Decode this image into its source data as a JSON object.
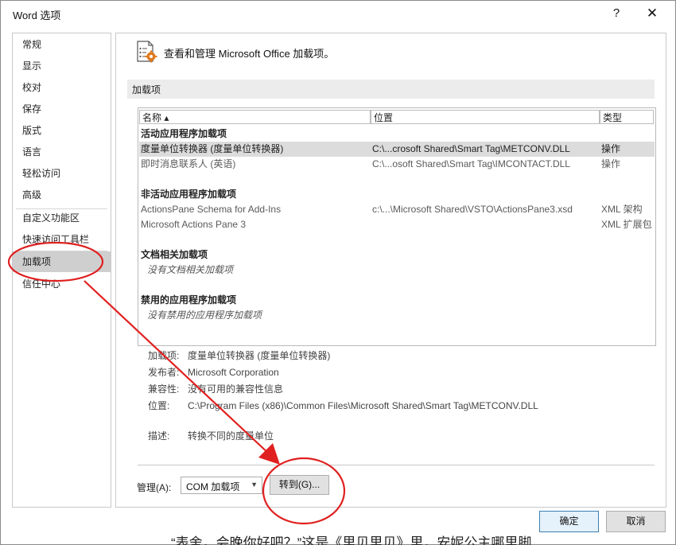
{
  "window": {
    "title": "Word 选项",
    "help": "?",
    "close": "✕"
  },
  "sidebar": {
    "items": [
      {
        "label": "常规"
      },
      {
        "label": "显示"
      },
      {
        "label": "校对"
      },
      {
        "label": "保存"
      },
      {
        "label": "版式"
      },
      {
        "label": "语言"
      },
      {
        "label": "轻松访问"
      },
      {
        "label": "高级"
      },
      {
        "label": "自定义功能区"
      },
      {
        "label": "快速访问工具栏"
      },
      {
        "label": "加载项",
        "selected": true
      },
      {
        "label": "信任中心"
      }
    ]
  },
  "main": {
    "header": "查看和管理 Microsoft Office 加载项。",
    "header_icon": "gear-addin-icon",
    "section_title": "加载项",
    "columns": {
      "name": "名称 ▴",
      "location": "位置",
      "type": "类型"
    },
    "groups": [
      {
        "title": "活动应用程序加载项",
        "rows": [
          {
            "name": "度量单位转换器 (度量单位转换器)",
            "location": "C:\\...crosoft Shared\\Smart Tag\\METCONV.DLL",
            "type": "操作",
            "selected": true
          },
          {
            "name": "即时消息联系人 (英语)",
            "location": "C:\\...osoft Shared\\Smart Tag\\IMCONTACT.DLL",
            "type": "操作"
          }
        ]
      },
      {
        "title": "非活动应用程序加载项",
        "rows": [
          {
            "name": "ActionsPane Schema for Add-Ins",
            "location": "c:\\...\\Microsoft Shared\\VSTO\\ActionsPane3.xsd",
            "type": "XML 架构"
          },
          {
            "name": "Microsoft Actions Pane 3",
            "location": "",
            "type": "XML 扩展包"
          }
        ]
      },
      {
        "title": "文档相关加载项",
        "empty": "没有文档相关加载项"
      },
      {
        "title": "禁用的应用程序加载项",
        "empty": "没有禁用的应用程序加载项"
      }
    ],
    "details": {
      "addin_label": "加载项:",
      "addin_value": "度量单位转换器 (度量单位转换器)",
      "publisher_label": "发布者:",
      "publisher_value": "Microsoft Corporation",
      "compat_label": "兼容性:",
      "compat_value": "没有可用的兼容性信息",
      "location_label": "位置:",
      "location_value": "C:\\Program Files (x86)\\Common Files\\Microsoft Shared\\Smart Tag\\METCONV.DLL",
      "desc_label": "描述:",
      "desc_value": "转换不同的度量单位"
    },
    "manage": {
      "label": "管理(A):",
      "selected": "COM 加载项",
      "goto": "转到(G)..."
    }
  },
  "footer": {
    "ok": "确定",
    "cancel": "取消"
  },
  "background_text": "“表舍，会晚你好吧？”这是《里贝里贝》里，安妮公主哪里脚",
  "annotation": {
    "color": "#e02020"
  }
}
